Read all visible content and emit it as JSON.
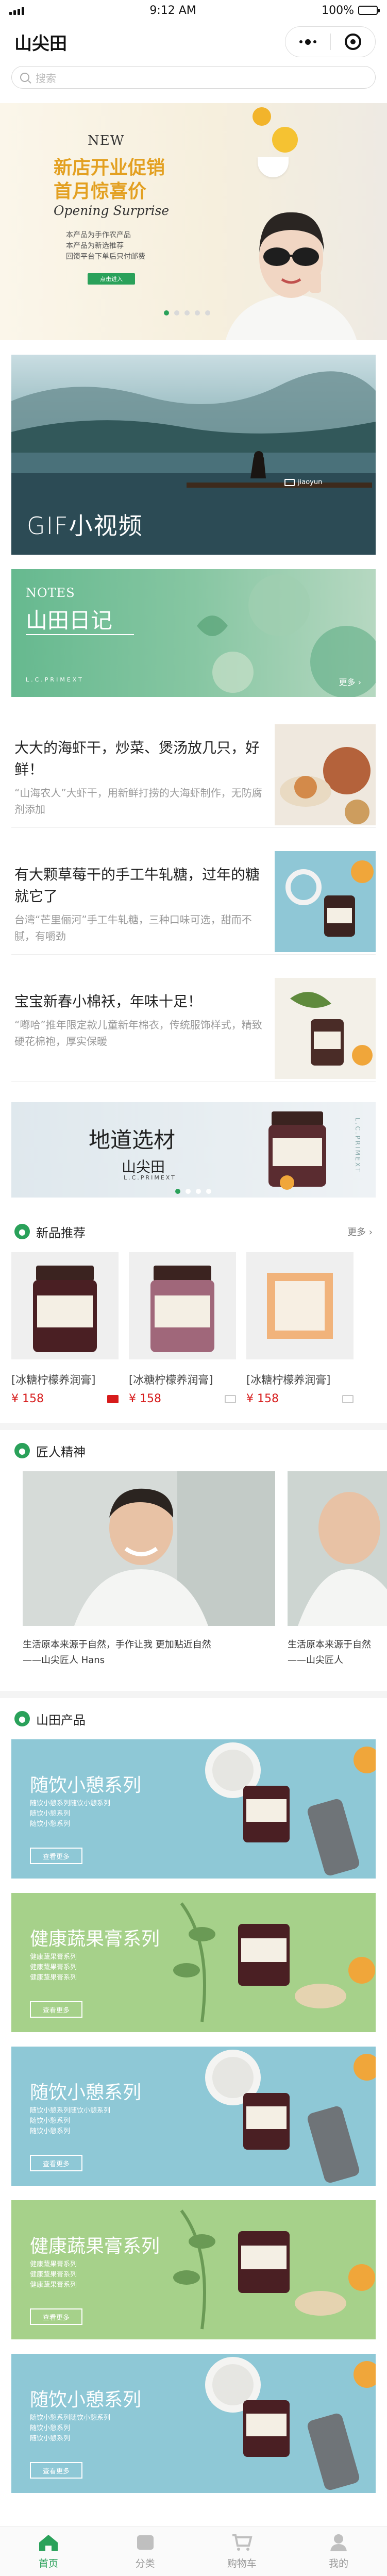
{
  "status": {
    "time": "9:12 AM",
    "battery": "100%",
    "battery_level": 1.0
  },
  "nav": {
    "title": "山尖田"
  },
  "search": {
    "placeholder": "搜索"
  },
  "hero": {
    "new": "NEW",
    "line1": "新店开业促销",
    "line2": "首月惊喜价",
    "line3": "Opening Surprise",
    "desc": "本产品为手作农产品\n本产品为新选推荐\n回馈平台下单后只付邮费",
    "pill": "点击进入",
    "active_index": 0,
    "count": 5
  },
  "gif_card": {
    "caption": "GIF小视频",
    "brand": "jiaoyun"
  },
  "notes_card": {
    "label": "NOTES",
    "title": "山田日记",
    "footer": "L.C.PRIMEXT",
    "more": "更多"
  },
  "articles": [
    {
      "title": "大大的海虾干，炒菜、煲汤放几只，好鲜！",
      "desc": "“山海农人”大虾干，用新鲜打捞的大海虾制作，无防腐剂添加"
    },
    {
      "title": "有大颗草莓干的手工牛轧糖，过年的糖就它了",
      "desc": "台湾“芒里俪河”手工牛轧糖，三种口味可选，甜而不腻，有嚼劲"
    },
    {
      "title": "宝宝新春小棉袄，年味十足！",
      "desc": "“嘟哈”推年限定款儿童新年棉衣，传统服饰样式，精致硬花棉袍，厚实保暖"
    }
  ],
  "origin_banner": {
    "title": "地道选材",
    "subtitle": "山尖田",
    "en": "L.C.PRIMEXT",
    "side": "L.C.PRIMEXT",
    "active_index": 0,
    "count": 4
  },
  "new_products": {
    "section_title": "新品推荐",
    "more": "更多",
    "items": [
      {
        "name": "[冰糖柠檬养润膏]",
        "price": "¥ 158"
      },
      {
        "name": "[冰糖柠檬养润膏]",
        "price": "¥ 158"
      },
      {
        "name": "[冰糖柠檬养润膏]",
        "price": "¥ 158"
      }
    ]
  },
  "craftsman": {
    "section_title": "匠人精神",
    "items": [
      {
        "caption": "生活原本来源于自然，手作让我 更加贴近自然\n——山尖匠人 Hans"
      },
      {
        "caption": "生活原本来源于自然\n——山尖匠人"
      }
    ]
  },
  "mountain_products": {
    "section_title": "山田产品",
    "series": [
      {
        "title": "随饮小憩系列",
        "desc": "随饮小憩系列随饮小憩系列\n随饮小憩系列\n随饮小憩系列",
        "button": "查看更多",
        "theme": "blue"
      },
      {
        "title": "健康蔬果膏系列",
        "desc": "健康蔬果膏系列\n健康蔬果膏系列\n健康蔬果膏系列",
        "button": "查看更多",
        "theme": "green"
      },
      {
        "title": "随饮小憩系列",
        "desc": "随饮小憩系列随饮小憩系列\n随饮小憩系列\n随饮小憩系列",
        "button": "查看更多",
        "theme": "blue"
      },
      {
        "title": "健康蔬果膏系列",
        "desc": "健康蔬果膏系列\n健康蔬果膏系列\n健康蔬果膏系列",
        "button": "查看更多",
        "theme": "green"
      },
      {
        "title": "随饮小憩系列",
        "desc": "随饮小憩系列随饮小憩系列\n随饮小憩系列\n随饮小憩系列",
        "button": "查看更多",
        "theme": "blue"
      }
    ]
  },
  "tabbar": {
    "items": [
      {
        "label": "首页",
        "icon": "home-icon",
        "active": true
      },
      {
        "label": "分类",
        "icon": "category-icon",
        "active": false
      },
      {
        "label": "购物车",
        "icon": "cart-icon",
        "active": false
      },
      {
        "label": "我的",
        "icon": "profile-icon",
        "active": false
      }
    ]
  },
  "colors": {
    "accent": "#2aa15a",
    "price": "#d71b1b",
    "promo": "#e3a021",
    "series_blue": "#8ec8d6",
    "series_green": "#a6d18a"
  }
}
